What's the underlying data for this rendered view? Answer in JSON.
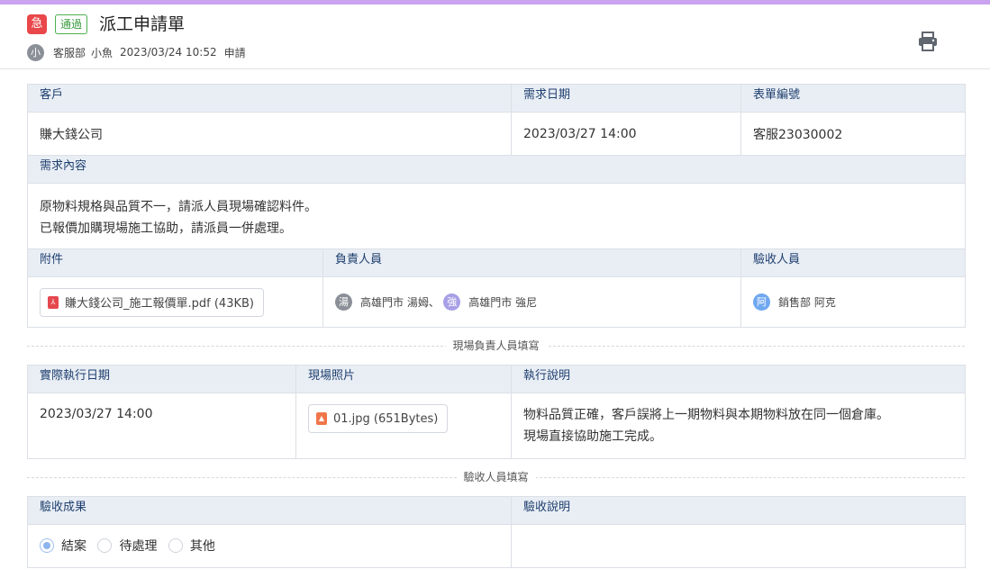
{
  "header": {
    "urgent_badge": "急",
    "status_badge": "通過",
    "title": "派工申請單",
    "applicant_avatar": "小",
    "department": "客服部",
    "applicant": "小魚",
    "datetime": "2023/03/24 10:52",
    "action": "申請",
    "print_icon": "printer-icon"
  },
  "info": {
    "customer_label": "客戶",
    "customer_value": "賺大錢公司",
    "date_label": "需求日期",
    "date_value": "2023/03/27 14:00",
    "form_no_label": "表單編號",
    "form_no_value": "客服23030002",
    "content_label": "需求內容",
    "content_line1": "原物料規格與品質不一，請派人員現場確認料件。",
    "content_line2": "已報價加購現場施工協助，請派員一併處理。",
    "attachment_label": "附件",
    "attachment_file": "賺大錢公司_施工報價單.pdf (43KB)",
    "assignee_label": "負責人員",
    "assignees": [
      {
        "avatar": "湯",
        "name": "高雄門市 湯姆",
        "sep": "、"
      },
      {
        "avatar": "強",
        "name": "高雄門市 強尼"
      }
    ],
    "inspector_label": "驗收人員",
    "inspector": {
      "avatar": "阿",
      "name": "銷售部 阿克"
    }
  },
  "field_section": {
    "divider_label": "現場負責人員填寫",
    "exec_date_label": "實際執行日期",
    "exec_date_value": "2023/03/27 14:00",
    "photo_label": "現場照片",
    "photo_file": "01.jpg (651Bytes)",
    "note_label": "執行說明",
    "note_line1": "物料品質正確，客戶誤將上一期物料與本期物料放在同一個倉庫。",
    "note_line2": "現場直接協助施工完成。"
  },
  "acceptance_section": {
    "divider_label": "驗收人員填寫",
    "result_label": "驗收成果",
    "options": [
      "結案",
      "待處理",
      "其他"
    ],
    "selected": "結案",
    "note_label": "驗收說明",
    "note_value": ""
  },
  "colors": {
    "accent_bar": "#c9a3ef",
    "urgent": "#e9474a",
    "pass": "#4caf50",
    "header_cell_bg": "#e9eef5",
    "header_cell_text": "#1e3f6e"
  }
}
